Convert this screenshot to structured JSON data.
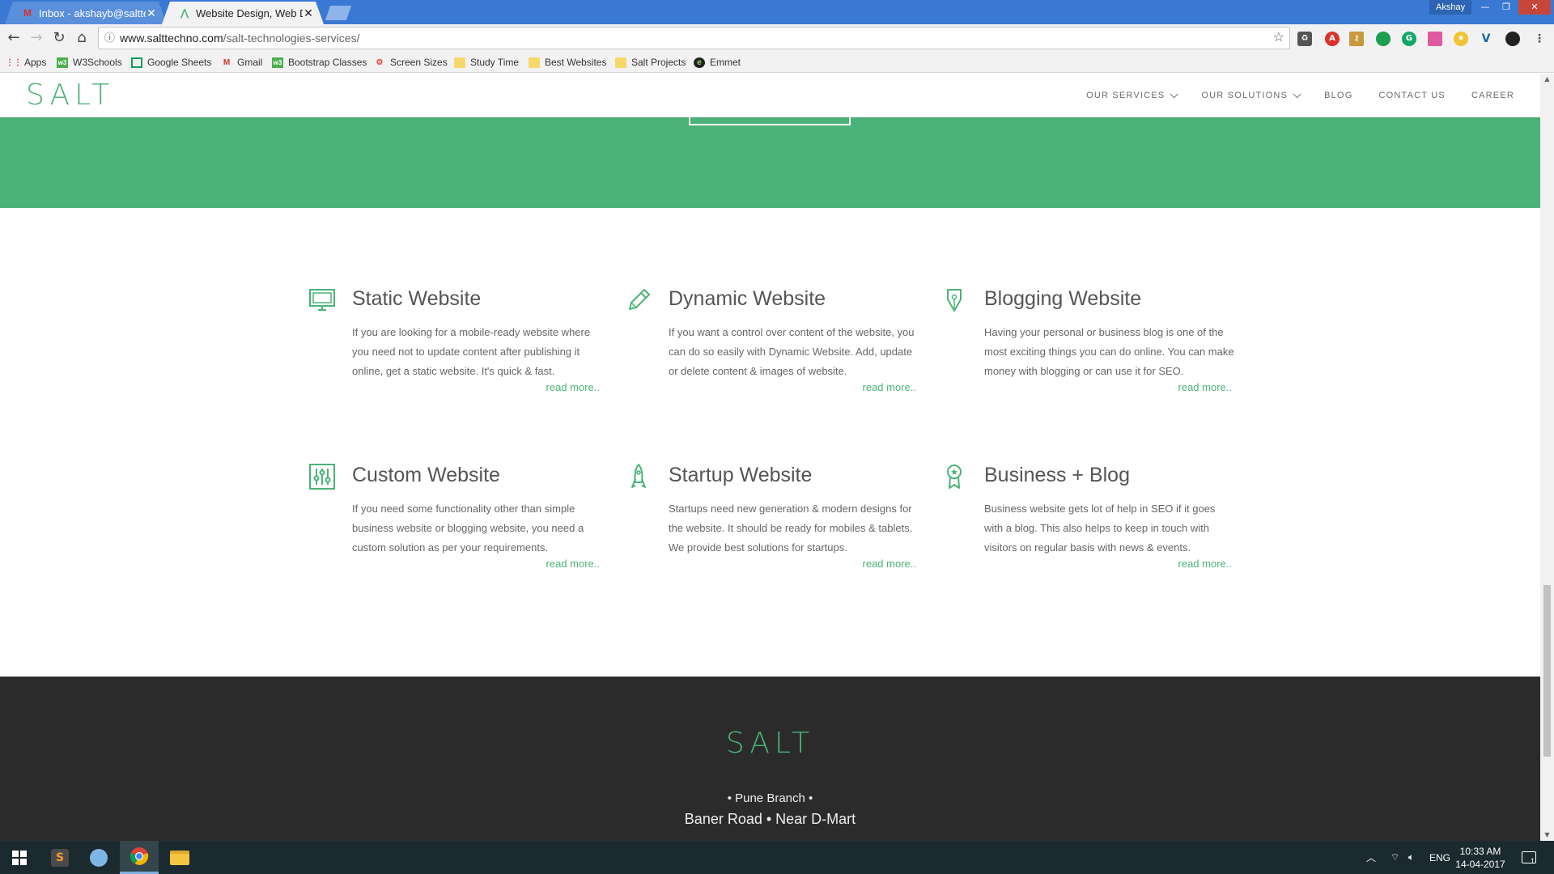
{
  "browser": {
    "tabs": [
      {
        "title": "Inbox - akshayb@saltte",
        "icon": "gmail-icon"
      },
      {
        "title": "Website Design, Web De",
        "icon": "salt-favicon-icon"
      }
    ],
    "profile_name": "Akshay",
    "window_controls": {
      "minimize": "—",
      "restore": "❐",
      "close": "✕"
    },
    "url_host": "www.salttechno.com",
    "url_path": "/salt-technologies-services/",
    "bookmarks": [
      {
        "label": "Apps",
        "icon": "apps-grid-icon"
      },
      {
        "label": "W3Schools",
        "icon": "w3schools-icon"
      },
      {
        "label": "Google Sheets",
        "icon": "sheets-icon"
      },
      {
        "label": "Gmail",
        "icon": "gmail-icon"
      },
      {
        "label": "Bootstrap Classes",
        "icon": "bootstrap-icon"
      },
      {
        "label": "Screen Sizes",
        "icon": "screen-sizes-icon"
      },
      {
        "label": "Study Time",
        "icon": "folder-icon"
      },
      {
        "label": "Best Websites",
        "icon": "folder-icon"
      },
      {
        "label": "Salt Projects",
        "icon": "folder-icon"
      },
      {
        "label": "Emmet",
        "icon": "emmet-icon"
      }
    ]
  },
  "site": {
    "logo": "SALT",
    "nav": [
      {
        "label": "OUR SERVICES",
        "dropdown": true
      },
      {
        "label": "OUR SOLUTIONS",
        "dropdown": true
      },
      {
        "label": "BLOG",
        "dropdown": false
      },
      {
        "label": "CONTACT US",
        "dropdown": false
      },
      {
        "label": "CAREER",
        "dropdown": false
      }
    ],
    "accent_color": "#4bb377",
    "services": [
      {
        "title": "Static Website",
        "icon": "monitor-icon",
        "text": "If you are looking for a mobile-ready website where you need not to update content after publishing it online, get a static website. It's quick & fast.",
        "more": "read more.."
      },
      {
        "title": "Dynamic Website",
        "icon": "pencil-icon",
        "text": "If you want a control over content of the website, you can do so easily with Dynamic Website. Add, update or delete content & images of website.",
        "more": "read more.."
      },
      {
        "title": "Blogging Website",
        "icon": "pen-nib-icon",
        "text": "Having your personal or business blog is one of the most exciting things you can do online. You can make money with blogging or can use it for SEO.",
        "more": "read more.."
      },
      {
        "title": "Custom Website",
        "icon": "sliders-icon",
        "text": "If you need some functionality other than simple business website or blogging website, you need a custom solution as per your requirements.",
        "more": "read more.."
      },
      {
        "title": "Startup Website",
        "icon": "rocket-icon",
        "text": "Startups need new generation & modern designs for the website. It should be ready for mobiles & tablets. We provide best solutions for startups.",
        "more": "read more.."
      },
      {
        "title": "Business + Blog",
        "icon": "award-icon",
        "text": "Business website gets lot of help in SEO if it goes with a blog. This also helps to keep in touch with visitors on regular basis with news & events.",
        "more": "read more.."
      }
    ],
    "footer": {
      "logo": "SALT",
      "branch": "• Pune Branch •",
      "address": "Baner Road • Near D-Mart"
    }
  },
  "taskbar": {
    "language": "ENG",
    "time": "10:33 AM",
    "date": "14-04-2017",
    "notification_count": "1"
  }
}
